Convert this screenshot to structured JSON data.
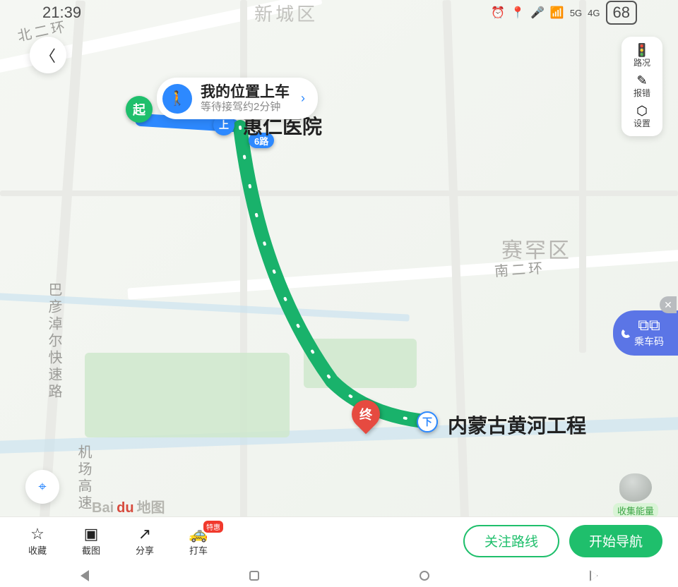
{
  "status": {
    "time": "21:39",
    "center": "新城区",
    "battery": "68",
    "signal5g": "5G",
    "signal4g": "4G"
  },
  "side_panel": {
    "traffic": "路况",
    "report": "报错",
    "settings": "设置"
  },
  "pickup": {
    "title": "我的位置上车",
    "subtitle": "等待接驾约2分钟"
  },
  "markers": {
    "start": "起",
    "board": "上",
    "line_badge": "6路",
    "alight": "下",
    "end": "终"
  },
  "map_labels": {
    "hospital": "惠仁医院",
    "destination": "内蒙古黄河工程",
    "district_saihan": "赛罕区",
    "road_n2r_north": "北二环",
    "road_n2r_south": "南二环",
    "road_bayan": "巴彦淖尔快速路",
    "road_airport": "机场高速"
  },
  "transit_code": {
    "label": "乘车码"
  },
  "energy": {
    "label": "收集能量"
  },
  "watermark": {
    "brand_prefix": "Bai",
    "brand_mid": "du",
    "suffix": "地图"
  },
  "toolbar": {
    "items": [
      {
        "label": "收藏"
      },
      {
        "label": "截图"
      },
      {
        "label": "分享"
      },
      {
        "label": "打车",
        "badge": "特惠"
      }
    ],
    "follow": "关注路线",
    "navigate": "开始导航"
  }
}
